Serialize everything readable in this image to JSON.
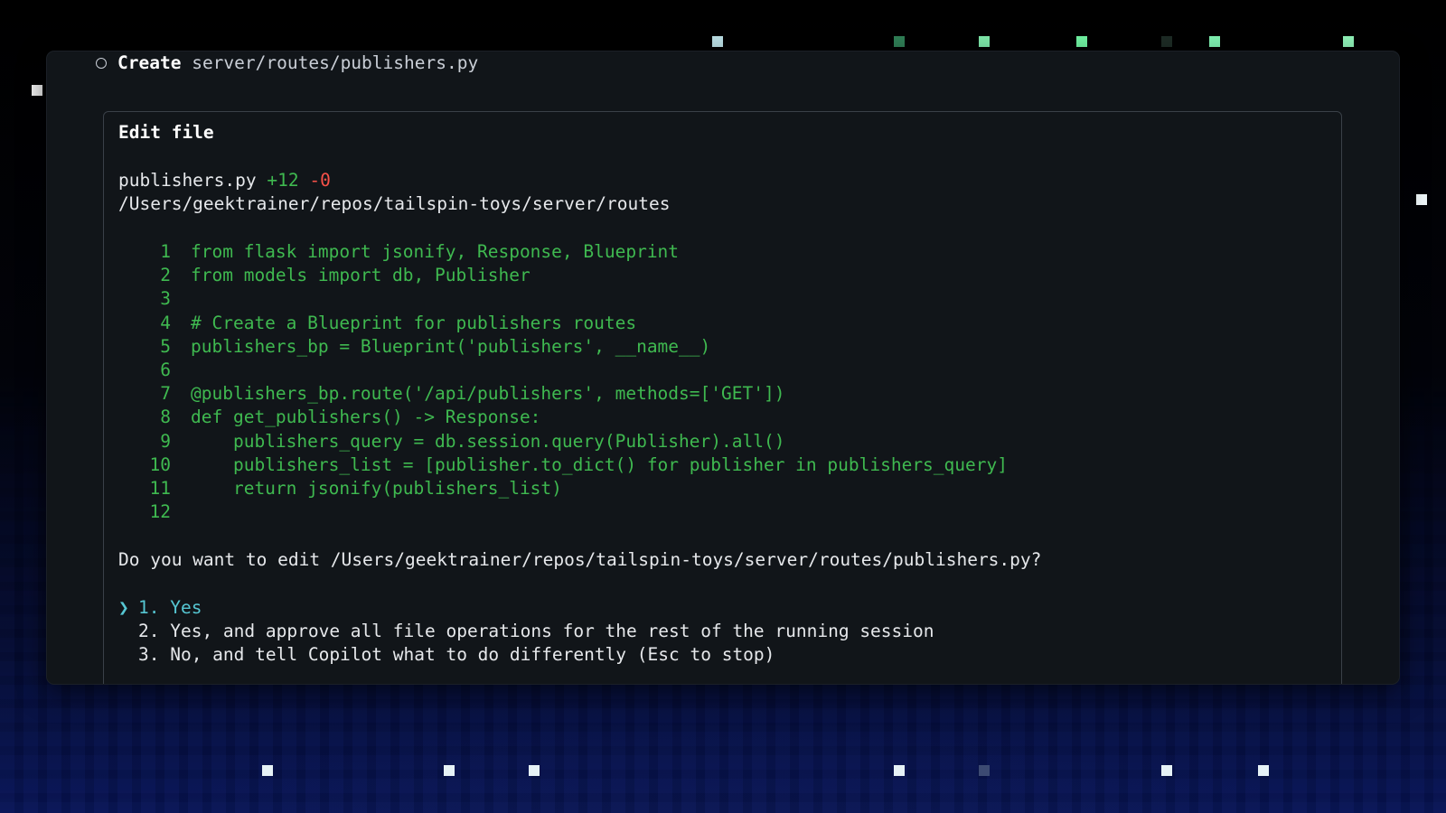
{
  "task": {
    "action": "Create",
    "path": "server/routes/publishers.py"
  },
  "panel": {
    "title": "Edit file",
    "filename": "publishers.py",
    "added": "+12",
    "removed": "-0",
    "directory": "/Users/geektrainer/repos/tailspin-toys/server/routes"
  },
  "code_lines": [
    {
      "num": "1",
      "text": "from flask import jsonify, Response, Blueprint"
    },
    {
      "num": "2",
      "text": "from models import db, Publisher"
    },
    {
      "num": "3",
      "text": ""
    },
    {
      "num": "4",
      "text": "# Create a Blueprint for publishers routes"
    },
    {
      "num": "5",
      "text": "publishers_bp = Blueprint('publishers', __name__)"
    },
    {
      "num": "6",
      "text": ""
    },
    {
      "num": "7",
      "text": "@publishers_bp.route('/api/publishers', methods=['GET'])"
    },
    {
      "num": "8",
      "text": "def get_publishers() -> Response:"
    },
    {
      "num": "9",
      "text": "    publishers_query = db.session.query(Publisher).all()"
    },
    {
      "num": "10",
      "text": "    publishers_list = [publisher.to_dict() for publisher in publishers_query]"
    },
    {
      "num": "11",
      "text": "    return jsonify(publishers_list)"
    },
    {
      "num": "12",
      "text": ""
    }
  ],
  "prompt": {
    "question": "Do you want to edit /Users/geektrainer/repos/tailspin-toys/server/routes/publishers.py?",
    "caret": "❯",
    "options": [
      {
        "label": "1. Yes",
        "selected": true
      },
      {
        "label": "2. Yes, and approve all file operations for the rest of the running session",
        "selected": false
      },
      {
        "label": "3. No, and tell Copilot what to do differently (Esc to stop)",
        "selected": false
      }
    ]
  },
  "colors": {
    "added": "#3fb950",
    "removed": "#f85149",
    "selected": "#56c7d3",
    "terminal_bg": "#111519"
  }
}
